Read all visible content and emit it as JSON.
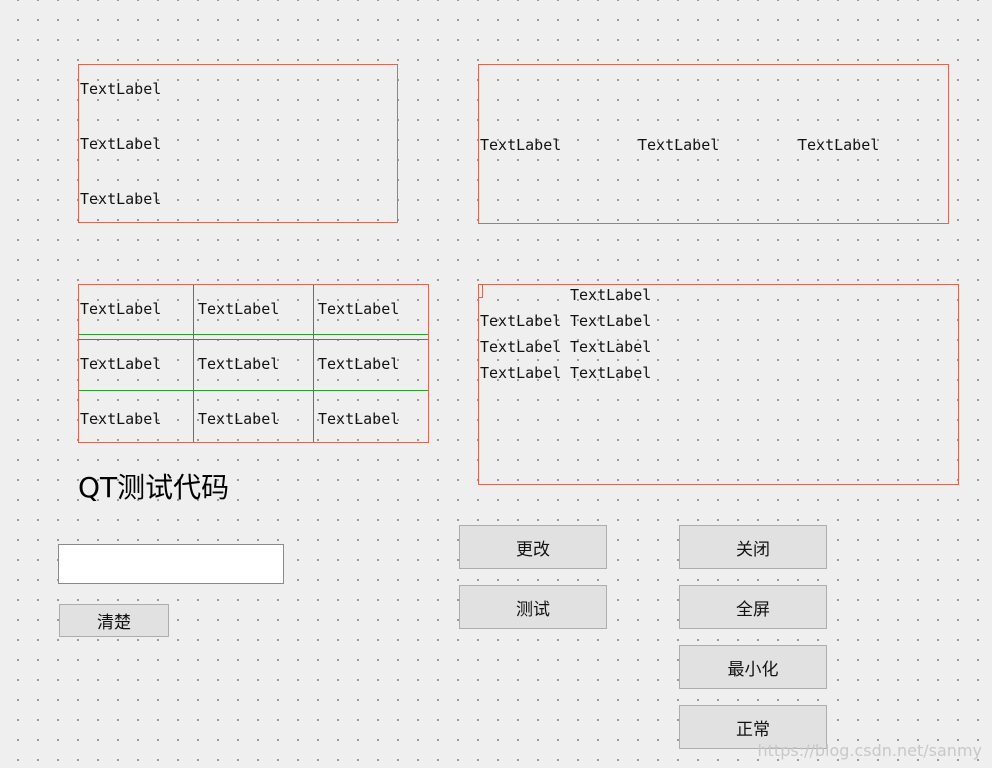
{
  "vbox_group": {
    "labels": [
      "TextLabel",
      "TextLabel",
      "TextLabel"
    ]
  },
  "hbox_group": {
    "labels": [
      "TextLabel",
      "TextLabel",
      "TextLabel"
    ]
  },
  "grid_group": {
    "rows": [
      [
        "TextLabel",
        "TextLabel",
        "TextLabel"
      ],
      [
        "TextLabel",
        "TextLabel",
        "TextLabel"
      ],
      [
        "TextLabel",
        "TextLabel",
        "TextLabel"
      ]
    ]
  },
  "form_group": {
    "header": "TextLabel",
    "rows": [
      [
        "TextLabel",
        "TextLabel"
      ],
      [
        "TextLabel",
        "TextLabel"
      ],
      [
        "TextLabel",
        "TextLabel"
      ]
    ]
  },
  "title": "QT测试代码",
  "input": {
    "value": ""
  },
  "buttons": {
    "clear": "清楚",
    "change": "更改",
    "test": "测试",
    "close": "关闭",
    "fullscreen": "全屏",
    "minimize": "最小化",
    "normal": "正常"
  },
  "watermark": "https://blog.csdn.net/sanmy",
  "colors": {
    "layout_border": "#d66a5a",
    "grid_line": "#2e9a2e",
    "background": "#efefef",
    "button_bg": "#e1e1e1"
  }
}
